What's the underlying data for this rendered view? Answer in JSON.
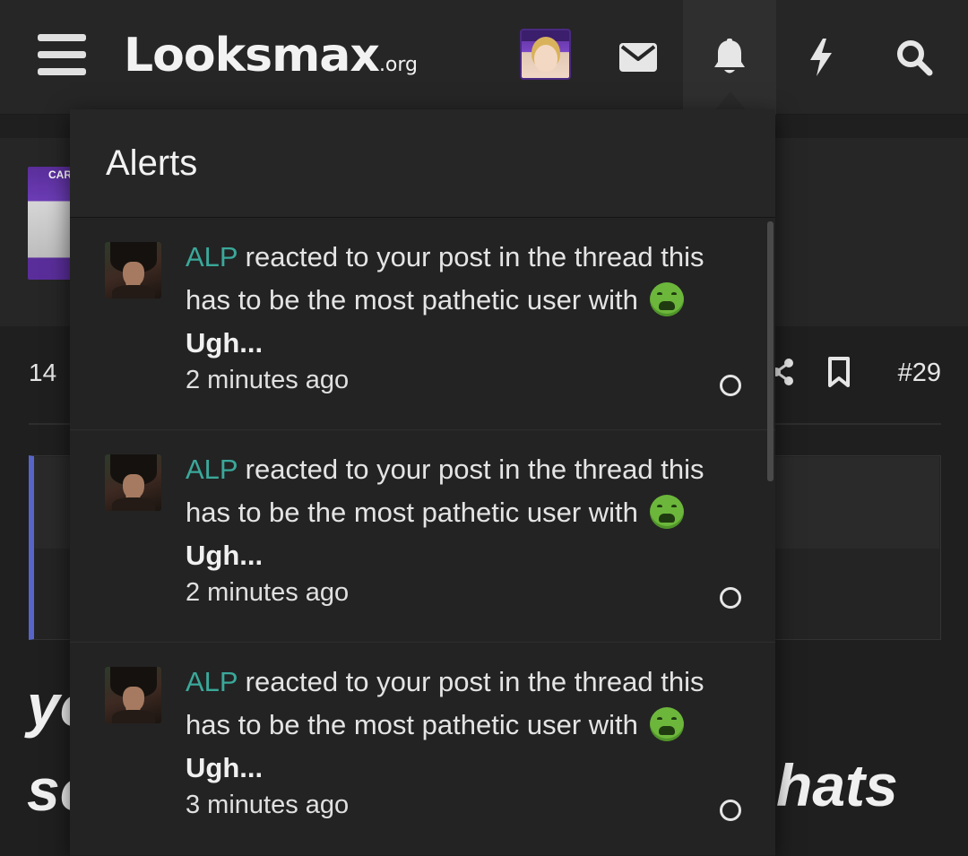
{
  "header": {
    "logo_text": "Looksmax",
    "logo_suffix": ".org",
    "icons": [
      "menu-icon",
      "envelope-icon",
      "bell-icon",
      "bolt-icon",
      "search-icon"
    ]
  },
  "underlying_post": {
    "thumb_label": "CARA",
    "meta_text": "14 ",
    "post_number": "#29",
    "body_line1": "yo",
    "body_line2": "so",
    "body_tail": "hats"
  },
  "alerts": {
    "title": "Alerts",
    "items": [
      {
        "user": "ALP",
        "action": " reacted to your post in the thread ",
        "thread": "this has to be the most pathetic user",
        "with_text": " with ",
        "reaction": "Ugh...",
        "time": "2 minutes ago"
      },
      {
        "user": "ALP",
        "action": " reacted to your post in the thread ",
        "thread": "this has to be the most pathetic user",
        "with_text": " with ",
        "reaction": "Ugh...",
        "time": "2 minutes ago"
      },
      {
        "user": "ALP",
        "action": " reacted to your post in the thread ",
        "thread": "this has to be the most pathetic user",
        "with_text": " with ",
        "reaction": "Ugh...",
        "time": "3 minutes ago"
      }
    ]
  },
  "colors": {
    "username": "#3aa89a",
    "reaction_emoji": "#6cb73b",
    "quote_accent": "#5865c8"
  }
}
